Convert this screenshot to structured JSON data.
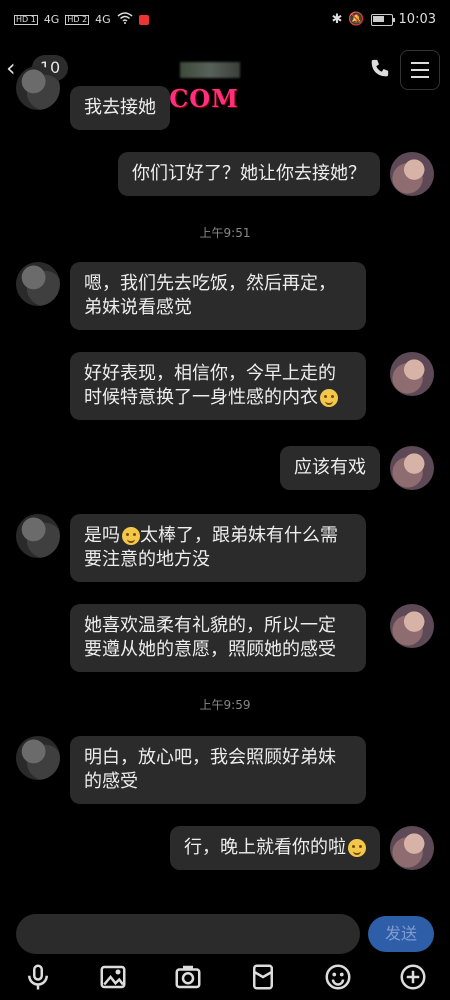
{
  "status": {
    "left": [
      "HD 1",
      "4G",
      "HD 2",
      "4G",
      "wifi"
    ],
    "time": "10:03",
    "battery": 0.6
  },
  "header": {
    "unread_count": "10",
    "watermark": "91P46.COM",
    "back_icon": "chevron-left-icon",
    "call_icon": "phone-icon",
    "menu_icon": "menu-icon"
  },
  "chat": {
    "messages": [
      {
        "side": "other",
        "text": "我去接她"
      },
      {
        "side": "me",
        "text": "你们订好了？她让你去接她？"
      },
      {
        "type": "time",
        "text": "上午9:51"
      },
      {
        "side": "other",
        "text": "嗯，我们先去吃饭，然后再定，弟妹说看感觉"
      },
      {
        "side": "me",
        "text": "好好表现，相信你，今早上走的时候特意换了一身性感的内衣",
        "emoji": true
      },
      {
        "side": "me",
        "text": "应该有戏"
      },
      {
        "side": "other",
        "text_a": "是吗",
        "text_b": "太棒了，跟弟妹有什么需要注意的地方没",
        "emoji_mid": true
      },
      {
        "side": "me",
        "text": "她喜欢温柔有礼貌的，所以一定要遵从她的意愿，照顾她的感受"
      },
      {
        "type": "time",
        "text": "上午9:59"
      },
      {
        "side": "other",
        "text": "明白，放心吧，我会照顾好弟妹的感受"
      },
      {
        "side": "me",
        "text": "行，晚上就看你的啦",
        "emoji": true
      }
    ]
  },
  "composer": {
    "placeholder": "",
    "send_label": "发送"
  },
  "toolbar": {
    "icons": [
      "mic-icon",
      "image-icon",
      "camera-icon",
      "red-packet-icon",
      "emoji-icon",
      "plus-icon"
    ]
  }
}
